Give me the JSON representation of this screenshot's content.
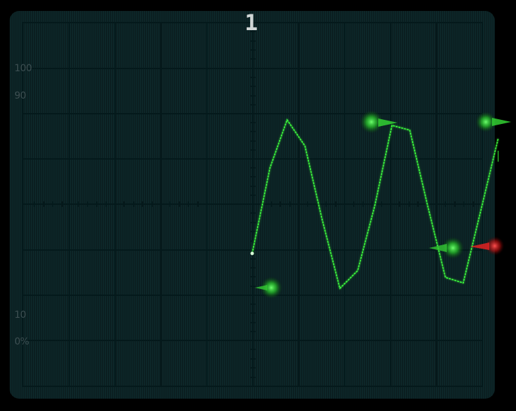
{
  "channel": {
    "number": "1"
  },
  "scale_labels": [
    "100",
    "90",
    "10",
    "0%"
  ],
  "colors": {
    "background": "#000000",
    "screen": "#0a1a1c",
    "grid": "#07282b",
    "trace": "#4cff4c",
    "trigger_marker": "#ff2a2a"
  },
  "markers": {
    "ground_level": "green-marker",
    "trigger_level": "red-marker"
  }
}
